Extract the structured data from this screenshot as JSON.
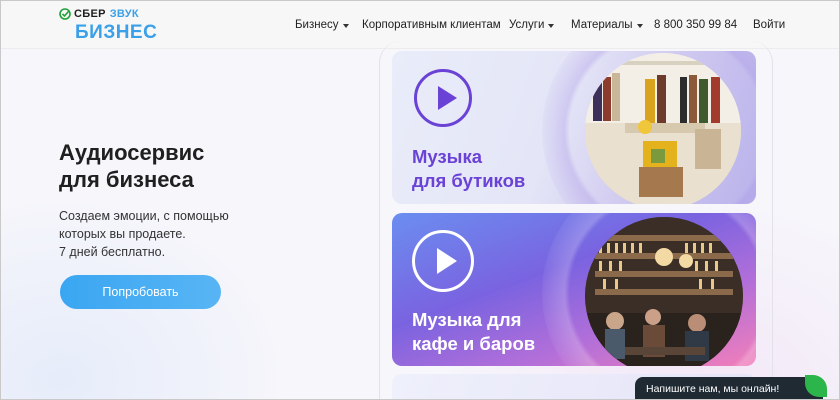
{
  "header": {
    "logo": {
      "sber": "СБЕР",
      "zvuk": "ЗВУК",
      "business": "БИЗНЕС"
    },
    "nav": [
      {
        "label": "Бизнесу",
        "has_dropdown": true
      },
      {
        "label": "Корпоративным клиентам",
        "has_dropdown": false
      },
      {
        "label": "Услуги",
        "has_dropdown": true
      },
      {
        "label": "Материалы",
        "has_dropdown": true
      },
      {
        "label": "8 800 350 99 84",
        "has_dropdown": false
      },
      {
        "label": "Войти",
        "has_dropdown": false
      }
    ]
  },
  "hero": {
    "title_line1": "Аудиосервис",
    "title_line2": "для бизнеса",
    "subtitle_line1": "Создаем эмоции, с помощью",
    "subtitle_line2": "которых вы продаете.",
    "subtitle_line3": "7 дней бесплатно.",
    "cta_label": "Попробовать"
  },
  "cards": [
    {
      "title_line1": "Музыка",
      "title_line2": "для бутиков"
    },
    {
      "title_line1": "Музыка для",
      "title_line2": "кафе и баров"
    }
  ],
  "chat": {
    "label": "Напишите нам, мы онлайн!"
  },
  "colors": {
    "accent": "#3aa0e8",
    "cta": "#4aaef3",
    "card_purple": "#6a42d6",
    "chat_bg": "#1f2a33",
    "chat_leaf": "#2cb54a"
  }
}
